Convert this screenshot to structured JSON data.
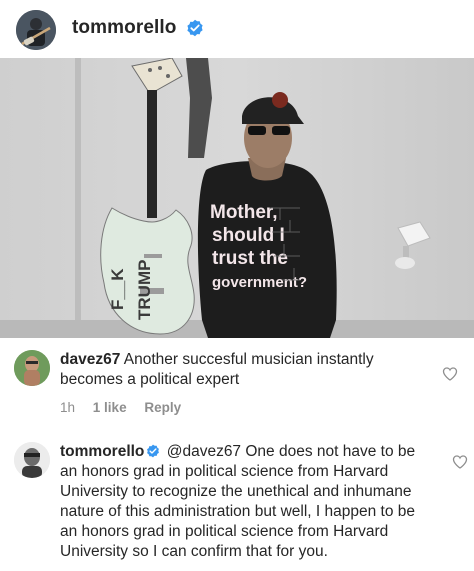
{
  "post": {
    "username": "tommorello",
    "verified": true
  },
  "photo": {
    "guitar_text_1": "F__K",
    "guitar_text_2": "TRUMP",
    "shirt_lines": [
      "Mother,",
      "should I",
      "trust the",
      "government?"
    ]
  },
  "comments": [
    {
      "username": "davez67",
      "text": "Another succesful musician instantly becomes a political expert",
      "time": "1h",
      "likes": "1 like",
      "reply_label": "Reply"
    },
    {
      "username": "tommorello",
      "verified": true,
      "mention": "@davez67",
      "text": "One does not have to be an honors grad in political science from Harvard University to recognize the unethical and inhumane nature of this administration but well, I happen to be an honors grad in political science from Harvard University so I can confirm that for you."
    }
  ],
  "colors": {
    "verified_blue": "#3897f0",
    "meta_gray": "#8e8e8e",
    "text": "#262626"
  }
}
